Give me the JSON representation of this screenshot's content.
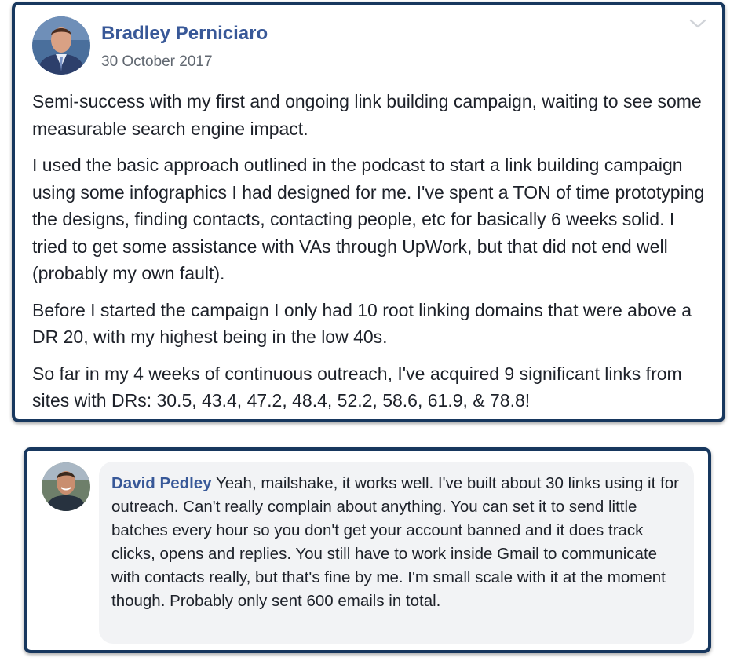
{
  "post": {
    "author": "Bradley Perniciaro",
    "date": "30 October 2017",
    "paragraphs": [
      "Semi-success with my first and ongoing link building campaign, waiting to see some measurable search engine impact.",
      "I used the basic approach outlined in the podcast to start a link building campaign using some infographics I had designed for me. I've spent a TON of time prototyping the designs, finding contacts, contacting people, etc for basically 6 weeks solid. I tried to get some assistance with VAs through UpWork, but that did not end well (probably my own fault).",
      "Before I started the campaign I only had 10 root linking domains that were above a DR 20, with my highest being in the low 40s.",
      "So far in my 4 weeks of continuous outreach, I've acquired 9 significant links from sites with DRs: 30.5, 43.4, 47.2, 48.4, 52.2, 58.6, 61.9, & 78.8!"
    ],
    "menu_icon": "chevron-down-icon"
  },
  "comment": {
    "author": "David Pedley",
    "text": "Yeah, mailshake, it works well. I've built about 30 links using it for outreach. Can't really complain about anything. You can set it to send little batches every hour so you don't get your account banned and it does track clicks, opens and replies. You still have to work inside Gmail to communicate with contacts really, but that's fine by me. I'm small scale with it at the moment though. Probably only sent 600 emails in total."
  },
  "colors": {
    "card_border": "#17375e",
    "author_link": "#385898",
    "comment_bubble": "#f2f3f5",
    "meta_text": "#606770"
  }
}
